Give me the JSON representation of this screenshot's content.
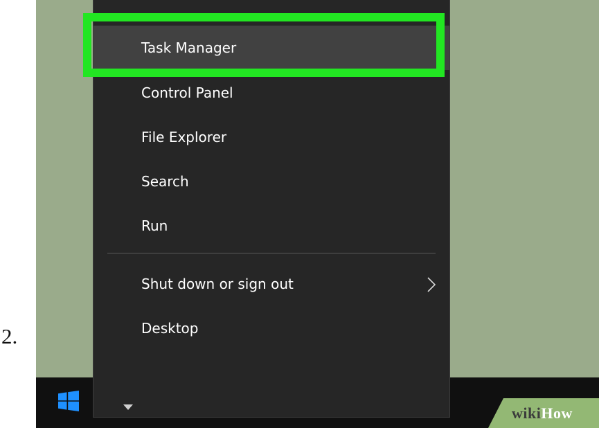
{
  "step": {
    "number": "2."
  },
  "menu": {
    "items": [
      {
        "label": "Task Manager",
        "highlighted": true
      },
      {
        "label": "Control Panel"
      },
      {
        "label": "File Explorer"
      },
      {
        "label": "Search"
      },
      {
        "label": "Run"
      },
      {
        "label": "Shut down or sign out",
        "has_submenu": true
      },
      {
        "label": "Desktop"
      }
    ]
  },
  "taskbar": {
    "start_icon": "windows-logo-icon",
    "expand_icon": "caret-down-icon"
  },
  "watermark": {
    "wiki": "wiki",
    "how": "How"
  },
  "colors": {
    "desktop_background": "#9aab8b",
    "menu_background": "#262626",
    "menu_highlight": "#414141",
    "highlight_box": "#22e622",
    "taskbar": "#101010",
    "windows_logo": "#1e90ff",
    "watermark_green": "#93b874"
  }
}
